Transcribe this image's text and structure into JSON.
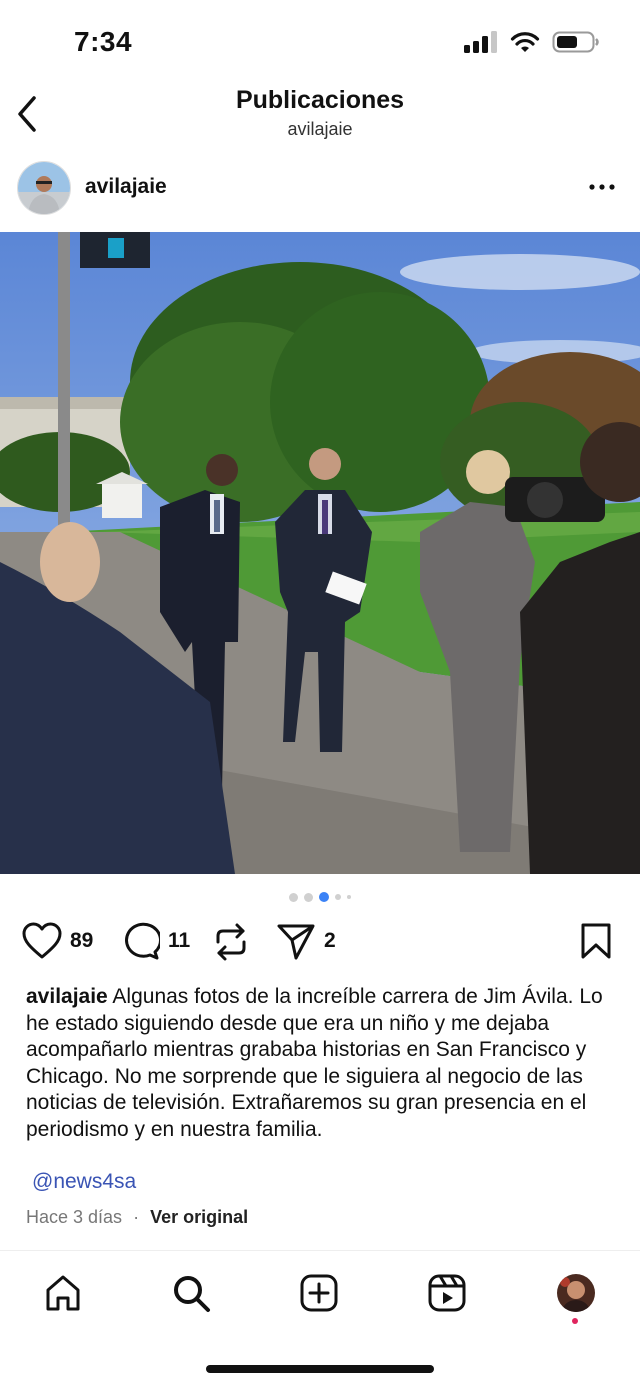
{
  "status_bar": {
    "time": "7:34",
    "icons": [
      "signal-icon",
      "wifi-icon",
      "battery-icon"
    ]
  },
  "header": {
    "title": "Publicaciones",
    "subtitle": "avilajaie"
  },
  "post": {
    "author": "avilajaie",
    "carousel": {
      "total_dots": 5,
      "active_index": 2
    },
    "actions": {
      "likes": "89",
      "comments": "11",
      "shares": "2"
    },
    "caption_user": "avilajaie",
    "caption_text": "Algunas fotos de la increíble carrera de Jim Ávila. Lo he estado siguiendo desde que era un niño y me dejaba acompañarlo mientras grababa historias en San Francisco y Chicago. No me sorprende que le siguiera al negocio de las noticias de televisión. Extrañaremos su gran presencia en el periodismo y en nuestra familia.",
    "mention": "@news4sa",
    "time_ago": "Hace 3 días",
    "separator": "·",
    "see_original": "Ver original"
  },
  "nav": {
    "items": [
      "home-icon",
      "search-icon",
      "create-icon",
      "reels-icon",
      "profile-avatar"
    ]
  },
  "colors": {
    "mention": "#3a54b4",
    "active_dot": "#3b82f6",
    "notification": "#e0245e"
  }
}
